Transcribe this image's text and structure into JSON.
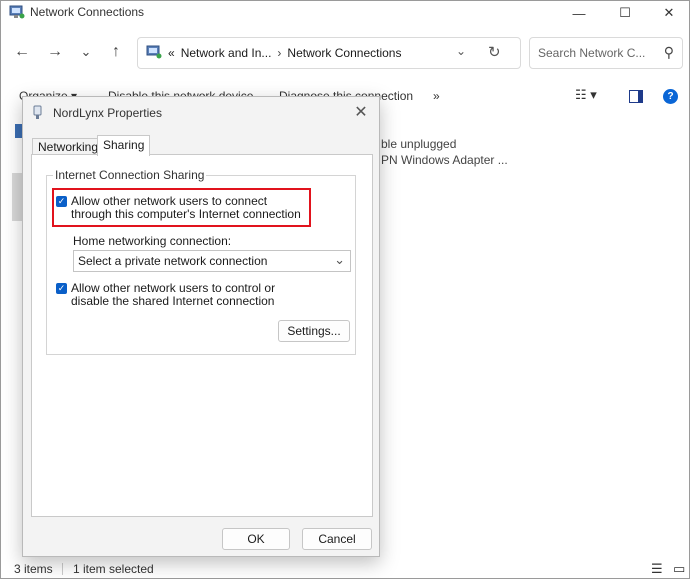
{
  "window": {
    "title": "Network Connections",
    "caption": {
      "minimize": "—",
      "maximize": "☐",
      "close": "✕"
    }
  },
  "nav": {
    "back": "←",
    "forward": "→",
    "recent": "⌄",
    "up": "↑",
    "overflow": "«",
    "breadcrumbs": [
      "Network and In...",
      "Network Connections"
    ],
    "separator": "›",
    "dropdown": "⌄",
    "refresh": "↻",
    "search_placeholder": "Search Network C...",
    "search_glyph": "⚲"
  },
  "command_bar": {
    "organize": "Organize ▾",
    "disable": "Disable this network device",
    "diagnose": "Diagnose this connection",
    "more": "»",
    "view_options": "☷ ▾",
    "help": "?"
  },
  "background_items": {
    "status1": "ble unplugged",
    "status2": "PN Windows Adapter ..."
  },
  "status_bar": {
    "count": "3 items",
    "selected": "1 item selected",
    "details_view": "☰",
    "tiles_view": "▭"
  },
  "dialog": {
    "title": "NordLynx Properties",
    "close": "✕",
    "tabs": [
      {
        "label": "Networking",
        "active": false
      },
      {
        "label": "Sharing",
        "active": true
      }
    ],
    "group_title": "Internet Connection Sharing",
    "allow_connect": {
      "label": "Allow other network users to connect through this computer's Internet connection",
      "checked": true
    },
    "home_label": "Home networking connection:",
    "home_select": "Select a private network connection",
    "allow_control": {
      "label": "Allow other network users to control or disable the shared Internet connection",
      "checked": true
    },
    "settings_button": "Settings...",
    "ok_button": "OK",
    "cancel_button": "Cancel",
    "check_glyph": "✓",
    "chevron_glyph": "⌄"
  },
  "colors": {
    "accent": "#0a5fc8",
    "highlight_box": "#e1131d",
    "dialog_bg": "#f3f3f3"
  }
}
